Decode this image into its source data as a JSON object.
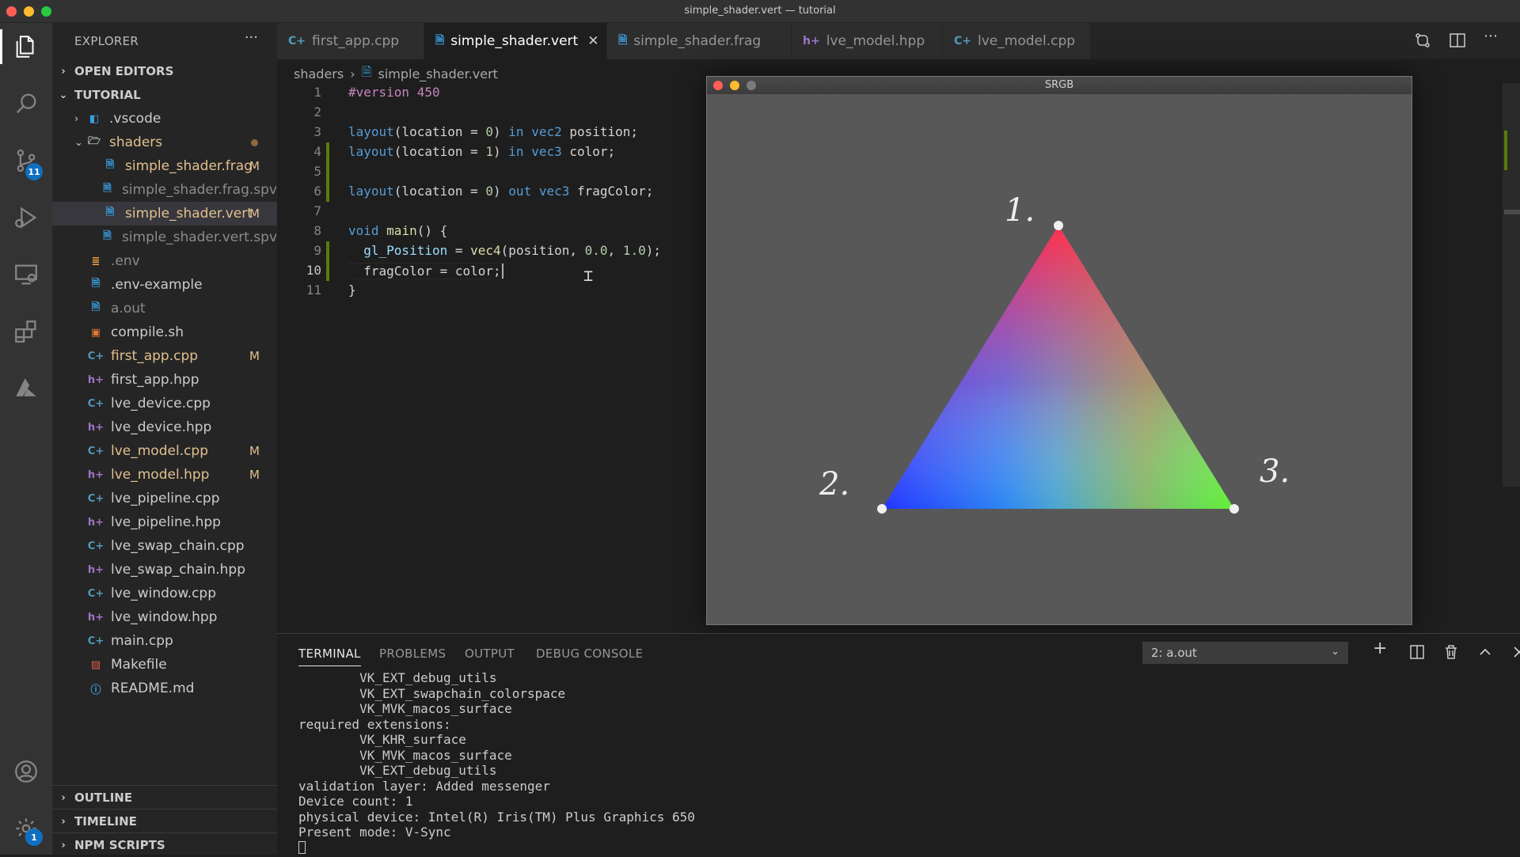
{
  "window": {
    "title": "simple_shader.vert — tutorial"
  },
  "activity": {
    "scm_badge": "11",
    "settings_badge": "1"
  },
  "sidebar": {
    "header": "EXPLORER",
    "more": "···",
    "open_editors": "OPEN EDITORS",
    "project": "TUTORIAL",
    "items": [
      {
        "label": ".vscode"
      },
      {
        "label": "shaders"
      },
      {
        "label": "simple_shader.frag",
        "status": "M"
      },
      {
        "label": "simple_shader.frag.spv"
      },
      {
        "label": "simple_shader.vert",
        "status": "M"
      },
      {
        "label": "simple_shader.vert.spv"
      },
      {
        "label": ".env"
      },
      {
        "label": ".env-example"
      },
      {
        "label": "a.out"
      },
      {
        "label": "compile.sh"
      },
      {
        "label": "first_app.cpp",
        "status": "M"
      },
      {
        "label": "first_app.hpp"
      },
      {
        "label": "lve_device.cpp"
      },
      {
        "label": "lve_device.hpp"
      },
      {
        "label": "lve_model.cpp",
        "status": "M"
      },
      {
        "label": "lve_model.hpp",
        "status": "M"
      },
      {
        "label": "lve_pipeline.cpp"
      },
      {
        "label": "lve_pipeline.hpp"
      },
      {
        "label": "lve_swap_chain.cpp"
      },
      {
        "label": "lve_swap_chain.hpp"
      },
      {
        "label": "lve_window.cpp"
      },
      {
        "label": "lve_window.hpp"
      },
      {
        "label": "main.cpp"
      },
      {
        "label": "Makefile"
      },
      {
        "label": "README.md"
      }
    ],
    "outline": "OUTLINE",
    "timeline": "TIMELINE",
    "npm_scripts": "NPM SCRIPTS"
  },
  "tabs": [
    {
      "label": "first_app.cpp"
    },
    {
      "label": "simple_shader.vert"
    },
    {
      "label": "simple_shader.frag"
    },
    {
      "label": "lve_model.hpp"
    },
    {
      "label": "lve_model.cpp"
    }
  ],
  "breadcrumb": {
    "folder": "shaders",
    "file": "simple_shader.vert"
  },
  "editor": {
    "lines": [
      "1",
      "2",
      "3",
      "4",
      "5",
      "6",
      "7",
      "8",
      "9",
      "10",
      "11"
    ],
    "code": {
      "l1": "#version 450",
      "l3a": "layout",
      "l3b": "(location = ",
      "l3c": "0",
      "l3d": ") ",
      "l3e": "in",
      "l3f": " ",
      "l3g": "vec2",
      "l3h": " position;",
      "l4a": "layout",
      "l4b": "(location = ",
      "l4c": "1",
      "l4d": ") ",
      "l4e": "in",
      "l4f": " ",
      "l4g": "vec3",
      "l4h": " color;",
      "l6a": "layout",
      "l6b": "(location = ",
      "l6c": "0",
      "l6d": ") ",
      "l6e": "out",
      "l6f": " ",
      "l6g": "vec3",
      "l6h": " fragColor;",
      "l8a": "void",
      "l8b": " ",
      "l8c": "main",
      "l8d": "() {",
      "l9a": "  ",
      "l9b": "gl_Position",
      "l9c": " = ",
      "l9d": "vec4",
      "l9e": "(position, ",
      "l9f": "0.0",
      "l9g": ", ",
      "l9h": "1.0",
      "l9i": ");",
      "l10a": "  fragColor = color;",
      "l11": "}"
    }
  },
  "srgb_window": {
    "title": "SRGB",
    "labels": {
      "top": "1.",
      "left": "2.",
      "right": "3."
    }
  },
  "panel": {
    "tabs": [
      "TERMINAL",
      "PROBLEMS",
      "OUTPUT",
      "DEBUG CONSOLE"
    ],
    "terminal_select": "2: a.out",
    "lines": [
      "        VK_EXT_debug_utils",
      "        VK_EXT_swapchain_colorspace",
      "        VK_MVK_macos_surface",
      "required extensions:",
      "        VK_KHR_surface",
      "        VK_MVK_macos_surface",
      "        VK_EXT_debug_utils",
      "validation layer: Added messenger",
      "Device count: 1",
      "physical device: Intel(R) Iris(TM) Plus Graphics 650",
      "Present mode: V-Sync"
    ]
  }
}
